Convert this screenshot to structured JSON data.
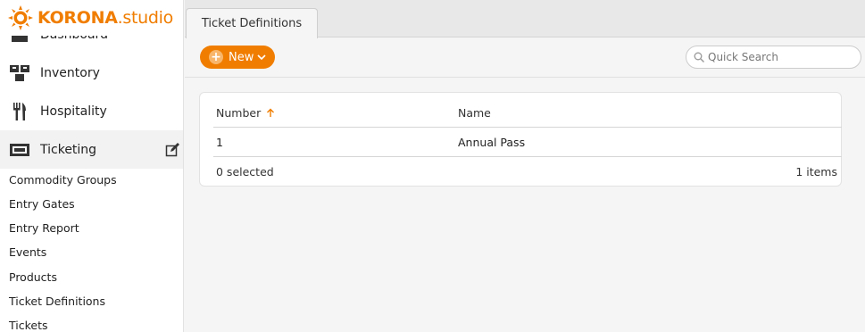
{
  "logo": {
    "brand": "KORONA",
    "suffix": ".studio"
  },
  "sidebar": {
    "items": [
      {
        "label": "Dashboard",
        "icon": "dashboard-icon"
      },
      {
        "label": "Inventory",
        "icon": "boxes-icon"
      },
      {
        "label": "Hospitality",
        "icon": "fork-knife-icon"
      },
      {
        "label": "Ticketing",
        "icon": "ticket-icon"
      }
    ],
    "ticketing_sub": [
      "Commodity Groups",
      "Entry Gates",
      "Entry Report",
      "Events",
      "Products",
      "Ticket Definitions",
      "Tickets"
    ]
  },
  "tabs": [
    {
      "label": "Ticket Definitions"
    }
  ],
  "toolbar": {
    "new_label": "New",
    "search_placeholder": "Quick Search"
  },
  "table": {
    "columns": [
      "Number",
      "Name"
    ],
    "sort": {
      "column": "Number",
      "direction": "ascending"
    },
    "rows": [
      {
        "number": "1",
        "name": "Annual Pass"
      }
    ],
    "selected_text": "0 selected",
    "count_text": "1 items"
  },
  "colors": {
    "accent": "#f07d00"
  }
}
